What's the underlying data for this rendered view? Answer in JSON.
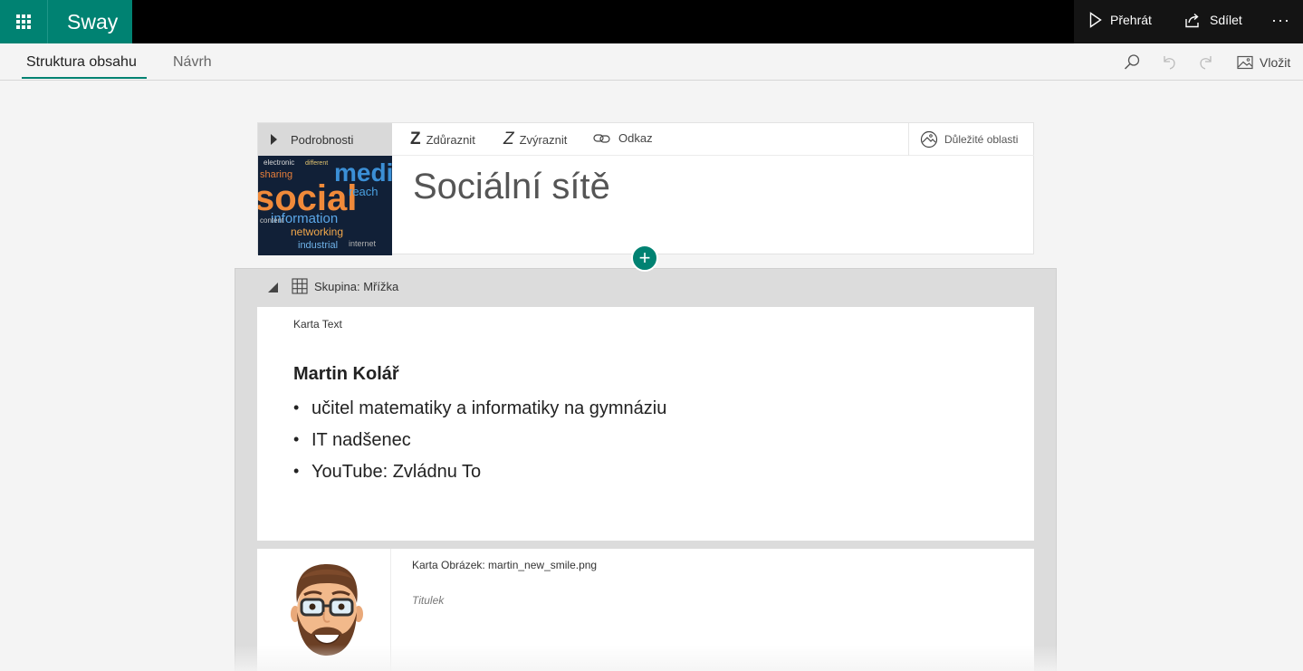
{
  "app": {
    "name": "Sway"
  },
  "topbar": {
    "play_label": "Přehrát",
    "share_label": "Sdílet",
    "more_label": "···"
  },
  "tabs": [
    {
      "label": "Struktura obsahu",
      "active": true
    },
    {
      "label": "Návrh",
      "active": false
    }
  ],
  "toolbar": {
    "insert_label": "Vložit"
  },
  "title_card": {
    "details_label": "Podrobnosti",
    "emphasize_label": "Zdůraznit",
    "highlight_label": "Zvýraznit",
    "link_label": "Odkaz",
    "focus_points_label": "Důležité oblasti",
    "title": "Sociální sítě",
    "image_words": [
      "social",
      "media",
      "information",
      "networking",
      "reach",
      "industrial",
      "sharing",
      "internet",
      "content",
      "electronic",
      "different"
    ]
  },
  "group": {
    "label": "Skupina: Mřížka",
    "text_card": {
      "label": "Karta Text",
      "heading": "Martin Kolář",
      "bullets": [
        "učitel matematiky a informatiky na gymnáziu",
        "IT nadšenec",
        "YouTube: Zvládnu To"
      ]
    },
    "image_card": {
      "label": "Karta Obrázek: martin_new_smile.png",
      "caption_placeholder": "Titulek"
    }
  },
  "colors": {
    "accent": "#008272",
    "topbar": "#000000"
  }
}
